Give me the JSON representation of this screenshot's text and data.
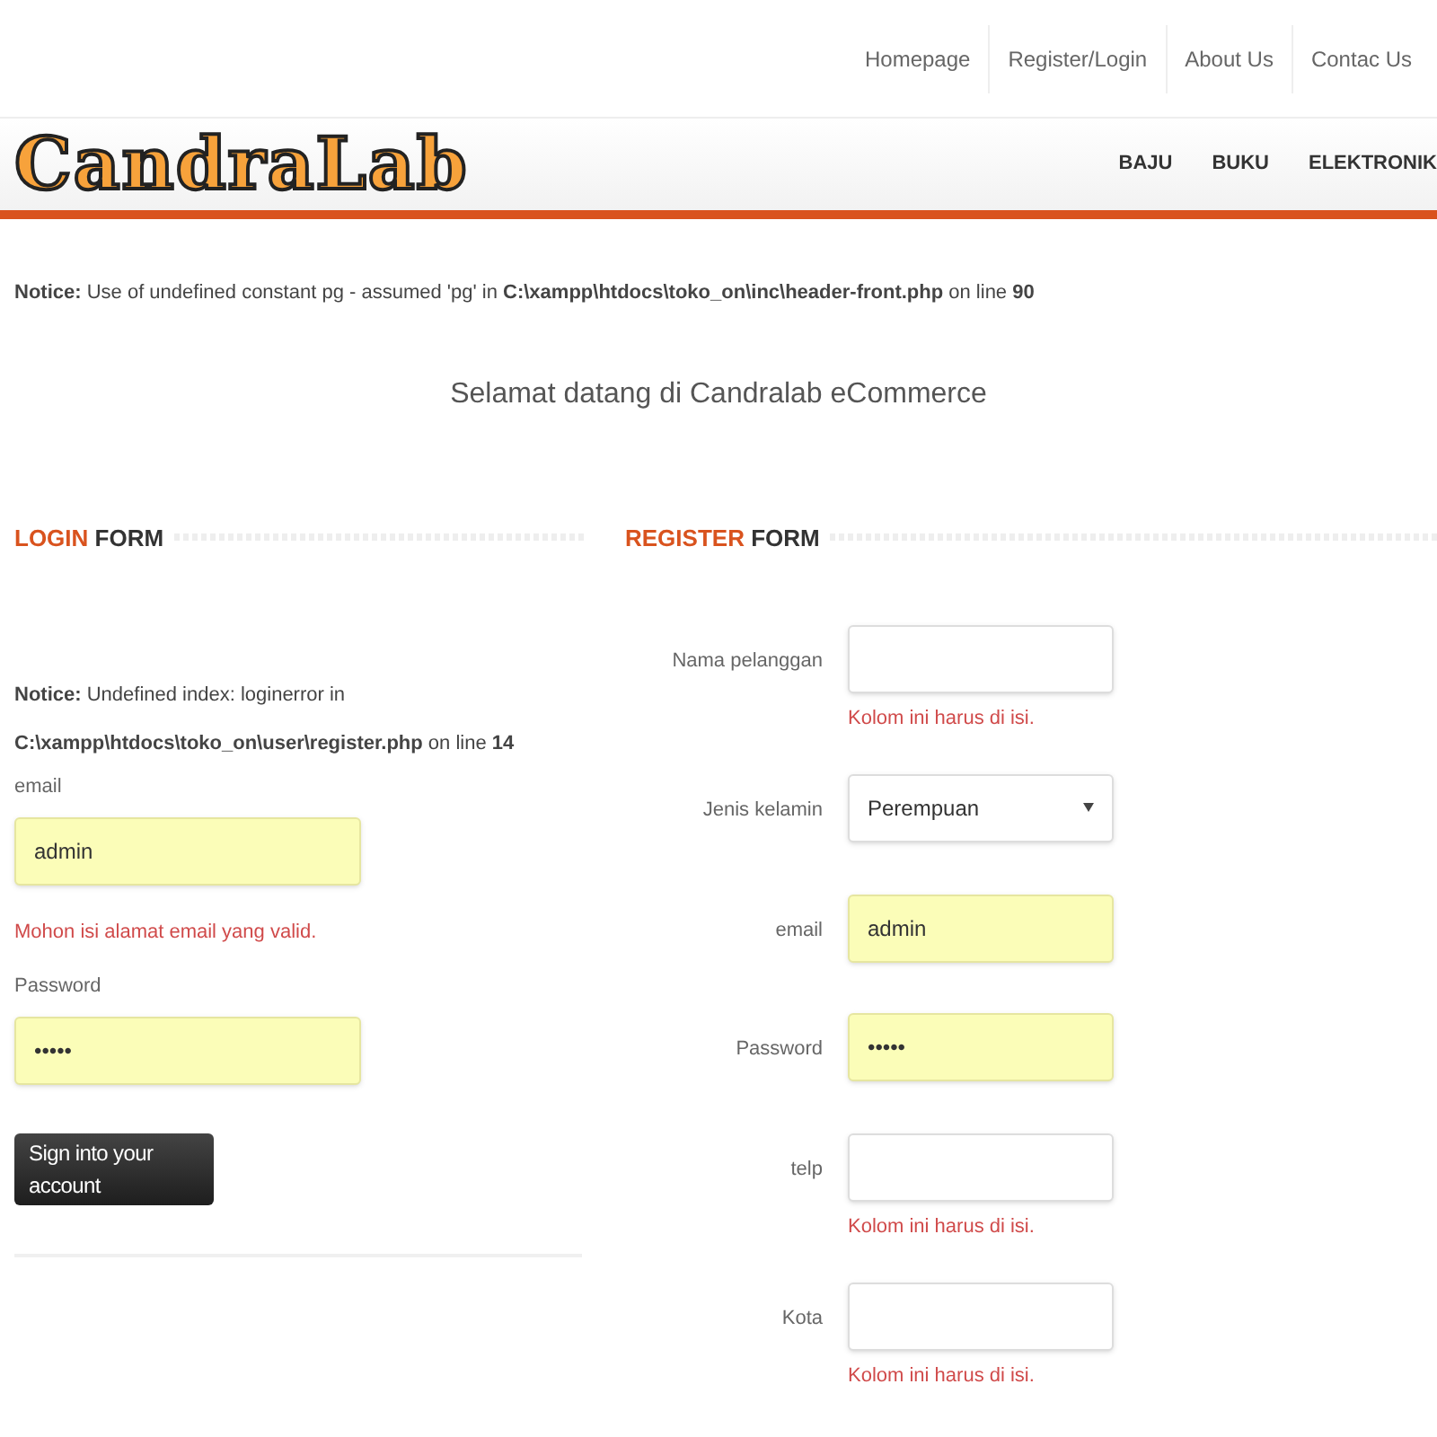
{
  "top_nav": [
    {
      "label": "Homepage"
    },
    {
      "label": "Register/Login"
    },
    {
      "label": "About Us"
    },
    {
      "label": "Contac Us"
    }
  ],
  "logo": "CandraLab",
  "categories": [
    {
      "label": "BAJU"
    },
    {
      "label": "BUKU"
    },
    {
      "label": "ELEKTRONIK"
    }
  ],
  "header_notice": "**Notice:** Use of undefined constant pg - assumed 'pg' in **C:\\xampp\\htdocs\\toko_on\\inc\\header-front.php** on line **90**",
  "welcome": "Selamat datang di Candralab eCommerce",
  "login": {
    "heading": {
      "accent": "LOGIN",
      "rest": "FORM"
    },
    "notice": "**Notice:** Undefined index: loginerror in **C:\\xampp\\htdocs\\toko_on\\user\\register.php** on line **14**",
    "fields": [
      {
        "label": "email",
        "value": "admin",
        "autofilled": true,
        "error": "Mohon isi alamat email yang valid."
      },
      {
        "label": "Password",
        "value": "•••••",
        "autofilled": true
      }
    ],
    "button": "Sign into your account"
  },
  "register": {
    "heading": {
      "accent": "REGISTER",
      "rest": "FORM"
    },
    "fields": [
      {
        "kind": "input",
        "label": "Nama pelanggan",
        "autofilled": false,
        "error": "Kolom ini harus di isi."
      },
      {
        "kind": "select",
        "label": "Jenis kelamin",
        "value": "Perempuan",
        "autofilled": false
      },
      {
        "kind": "input",
        "label": "email",
        "value": "admin",
        "autofilled": true
      },
      {
        "kind": "input",
        "label": "Password",
        "value": "•••••",
        "autofilled": true
      },
      {
        "kind": "input",
        "label": "telp",
        "autofilled": false,
        "error": "Kolom ini harus di isi."
      },
      {
        "kind": "input",
        "label": "Kota",
        "autofilled": false,
        "error": "Kolom ini harus di isi."
      }
    ]
  }
}
